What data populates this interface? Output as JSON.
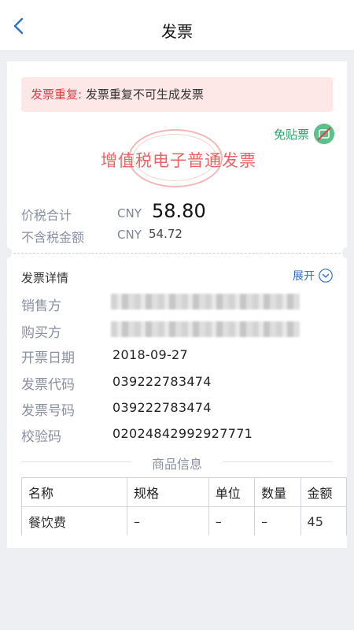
{
  "nav": {
    "title": "发票"
  },
  "alert": {
    "label": "发票重复:",
    "message": "发票重复不可生成发票"
  },
  "nostamp": {
    "label": "免贴票"
  },
  "invoice": {
    "stamp_title": "增值税电子普通发票",
    "total_label": "价税合计",
    "total_currency": "CNY",
    "total_value": "58.80",
    "pretax_label": "不含税金额",
    "pretax_currency": "CNY",
    "pretax_value": "54.72"
  },
  "details": {
    "title": "发票详情",
    "expand_label": "展开",
    "rows": [
      {
        "label": "销售方",
        "value": ""
      },
      {
        "label": "购买方",
        "value": ""
      },
      {
        "label": "开票日期",
        "value": "2018-09-27"
      },
      {
        "label": "发票代码",
        "value": "039222783474"
      },
      {
        "label": "发票号码",
        "value": "039222783474"
      },
      {
        "label": "校验码",
        "value": "02024842992927771"
      }
    ]
  },
  "goods": {
    "title": "商品信息",
    "columns": [
      "名称",
      "规格",
      "单位",
      "数量",
      "金额"
    ],
    "rows": [
      [
        "餐饮费",
        "–",
        "–",
        "–",
        "45"
      ]
    ]
  },
  "colors": {
    "accent": "#2f6fc4",
    "alert": "#e0404a",
    "green": "#2aa46a",
    "stamp": "#ec6466"
  },
  "icons": {
    "back": "chevron-left-icon",
    "nostamp": "no-stamp-icon",
    "expand": "chevron-down-circle-icon"
  }
}
